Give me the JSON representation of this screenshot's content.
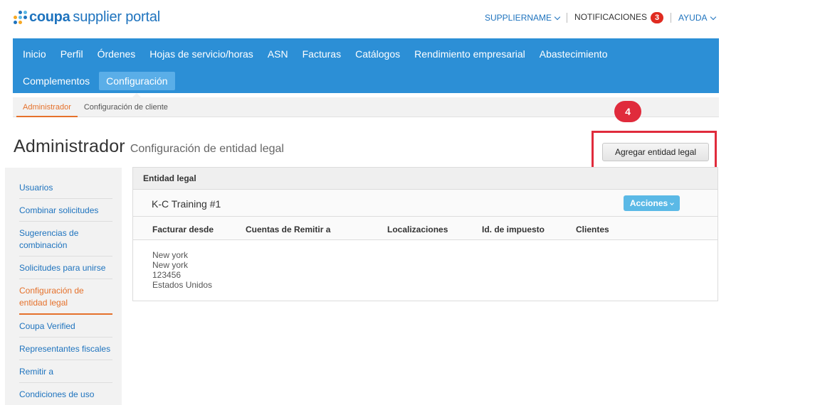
{
  "logo": {
    "brand": "coupa",
    "product": "supplier portal"
  },
  "top_links": {
    "supplier": "SUPPLIERNAME",
    "notifications": "NOTIFICACIONES",
    "notification_count": "3",
    "help": "AYUDA"
  },
  "nav": {
    "row1": [
      "Inicio",
      "Perfil",
      "Órdenes",
      "Hojas de servicio/horas",
      "ASN",
      "Facturas",
      "Catálogos",
      "Rendimiento empresarial",
      "Abastecimiento"
    ],
    "row2": [
      "Complementos",
      "Configuración"
    ],
    "active": "Configuración"
  },
  "subnav": {
    "items": [
      "Administrador",
      "Configuración de cliente"
    ],
    "active": "Administrador"
  },
  "page": {
    "title": "Administrador",
    "subtitle": "Configuración de entidad legal"
  },
  "add_button": "Agregar entidad legal",
  "step_badge": "4",
  "sidebar": {
    "items": [
      "Usuarios",
      "Combinar solicitudes",
      "Sugerencias de combinación",
      "Solicitudes para unirse",
      "Configuración de entidad legal",
      "Coupa Verified",
      "Representantes fiscales",
      "Remitir a",
      "Condiciones de uso"
    ],
    "active_index": 4
  },
  "table": {
    "header": "Entidad legal",
    "entity_name": "K-C Training #1",
    "actions_label": "Acciones",
    "columns": [
      "Facturar desde",
      "Cuentas de Remitir a",
      "Localizaciones",
      "Id. de impuesto",
      "Clientes"
    ],
    "address": [
      "New york",
      "New york",
      "123456",
      "Estados Unidos"
    ]
  },
  "colors": {
    "nav_blue": "#2c8fd6",
    "link_blue": "#1e73be",
    "accent_orange": "#e5712b",
    "highlight_red": "#e02b3c",
    "actions_blue": "#5bb9e6"
  }
}
